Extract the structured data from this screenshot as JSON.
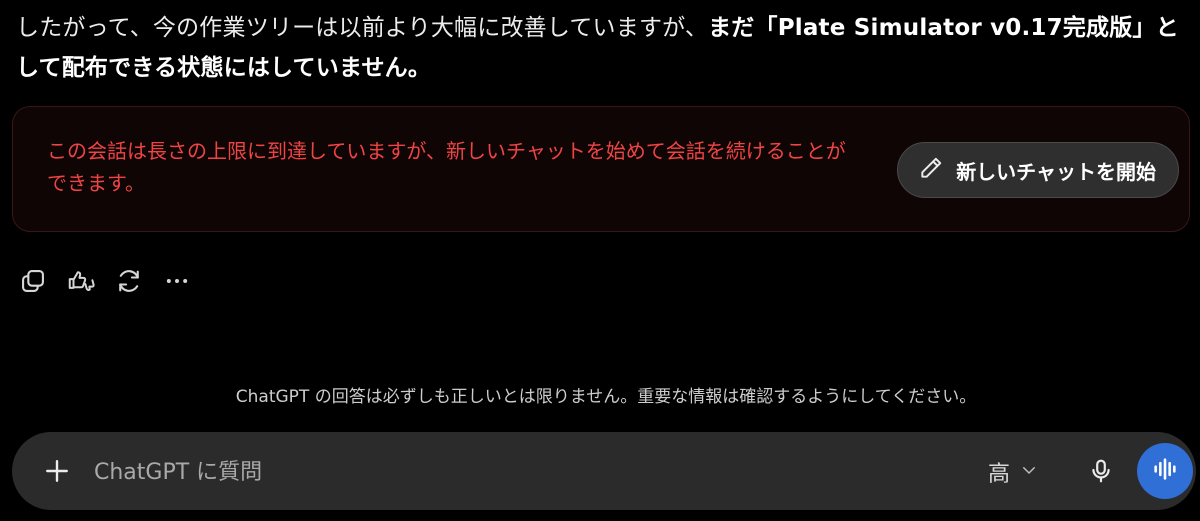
{
  "message": {
    "text_normal": "したがって、今の作業ツリーは以前より大幅に改善していますが、",
    "text_bold": "まだ「Plate Simulator v0.17完成版」として配布できる状態にはしていません。"
  },
  "limit_notice": {
    "text": "この会話は長さの上限に到達していますが、新しいチャットを始めて会話を続けることができます。",
    "button_label": "新しいチャットを開始",
    "button_icon": "pencil-icon",
    "text_color": "#ef4444"
  },
  "actions": {
    "icons": [
      "copy-icon",
      "thumbs-up-down-icon",
      "regenerate-icon",
      "more-icon"
    ]
  },
  "disclaimer": "ChatGPT の回答は必ずしも正しいとは限りません。重要な情報は確認するようにしてください。",
  "composer": {
    "placeholder": "ChatGPT に質問",
    "model_label": "高",
    "voice_button_color": "#2f6fd6"
  }
}
